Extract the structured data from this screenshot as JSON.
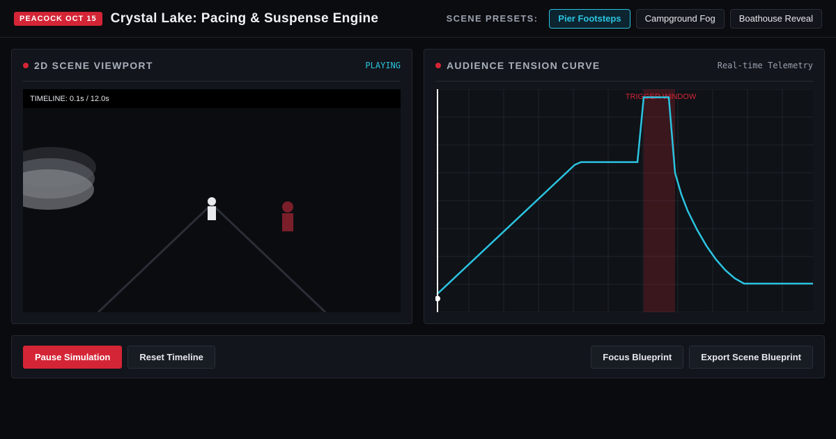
{
  "header": {
    "badge": "PEACOCK OCT 15",
    "title": "Crystal Lake: Pacing & Suspense Engine",
    "presets_label": "SCENE PRESETS:",
    "presets": [
      {
        "label": "Pier Footsteps",
        "active": true
      },
      {
        "label": "Campground Fog",
        "active": false
      },
      {
        "label": "Boathouse Reveal",
        "active": false
      }
    ]
  },
  "viewport": {
    "title": "2D SCENE VIEWPORT",
    "status": "PLAYING",
    "timeline": "TIMELINE: 0.1s / 12.0s"
  },
  "tension": {
    "title": "AUDIENCE TENSION CURVE",
    "status": "Real-time Telemetry",
    "trigger_label": "TRIGGER WINDOW",
    "colors": {
      "curve": "#2bc4e0",
      "trigger": "#d42536"
    }
  },
  "chart_data": {
    "type": "line",
    "title": "AUDIENCE TENSION CURVE",
    "xlabel": "",
    "ylabel": "",
    "xlim": [
      0,
      12
    ],
    "ylim": [
      0,
      8
    ],
    "grid": true,
    "playhead_x": 0.1,
    "trigger_window": [
      6.6,
      7.6
    ],
    "series": [
      {
        "name": "",
        "x": [
          0,
          4.4,
          4.6,
          6.4,
          6.6,
          7.4,
          7.6,
          7.8,
          8.0,
          8.3,
          8.6,
          8.9,
          9.2,
          9.5,
          9.8,
          10.0,
          12.0
        ],
        "y": [
          0.4,
          5.2,
          5.3,
          5.3,
          7.7,
          7.7,
          4.9,
          4.1,
          3.5,
          2.8,
          2.2,
          1.7,
          1.3,
          1.0,
          0.8,
          0.8,
          0.8
        ]
      }
    ]
  },
  "controls": {
    "pause": "Pause Simulation",
    "reset": "Reset Timeline",
    "focus": "Focus Blueprint",
    "export": "Export Scene Blueprint"
  }
}
